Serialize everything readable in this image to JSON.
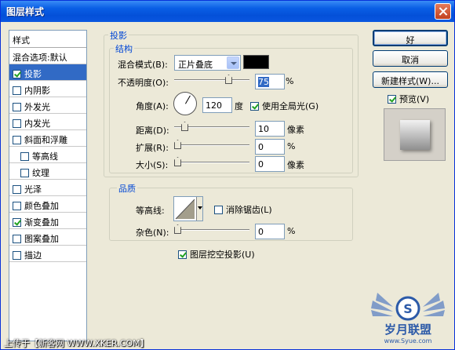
{
  "window": {
    "title": "图层样式"
  },
  "styles_list": {
    "header": "样式",
    "items": [
      {
        "label": "混合选项:默认",
        "checkbox": false,
        "checked": false,
        "selected": false,
        "indent": false
      },
      {
        "label": "投影",
        "checkbox": true,
        "checked": true,
        "selected": true,
        "indent": false
      },
      {
        "label": "内阴影",
        "checkbox": true,
        "checked": false,
        "selected": false,
        "indent": false
      },
      {
        "label": "外发光",
        "checkbox": true,
        "checked": false,
        "selected": false,
        "indent": false
      },
      {
        "label": "内发光",
        "checkbox": true,
        "checked": false,
        "selected": false,
        "indent": false
      },
      {
        "label": "斜面和浮雕",
        "checkbox": true,
        "checked": false,
        "selected": false,
        "indent": false
      },
      {
        "label": "等高线",
        "checkbox": true,
        "checked": false,
        "selected": false,
        "indent": true
      },
      {
        "label": "纹理",
        "checkbox": true,
        "checked": false,
        "selected": false,
        "indent": true
      },
      {
        "label": "光泽",
        "checkbox": true,
        "checked": false,
        "selected": false,
        "indent": false
      },
      {
        "label": "颜色叠加",
        "checkbox": true,
        "checked": false,
        "selected": false,
        "indent": false
      },
      {
        "label": "渐变叠加",
        "checkbox": true,
        "checked": true,
        "selected": false,
        "indent": false
      },
      {
        "label": "图案叠加",
        "checkbox": true,
        "checked": false,
        "selected": false,
        "indent": false
      },
      {
        "label": "描边",
        "checkbox": true,
        "checked": false,
        "selected": false,
        "indent": false
      }
    ]
  },
  "drop_shadow": {
    "section_title": "投影",
    "structure_title": "结构",
    "blend_mode_label": "混合模式(B):",
    "blend_mode_value": "正片叠底",
    "shadow_color": "#000000",
    "opacity_label": "不透明度(O):",
    "opacity_value": "75",
    "opacity_unit": "%",
    "opacity_level": 0.75,
    "angle_label": "角度(A):",
    "angle_value": "120",
    "angle_unit": "度",
    "global_light_label": "使用全局光(G)",
    "global_light_checked": true,
    "distance_label": "距离(D):",
    "distance_value": "10",
    "distance_unit": "像素",
    "distance_level": 0.1,
    "spread_label": "扩展(R):",
    "spread_value": "0",
    "spread_unit": "%",
    "size_label": "大小(S):",
    "size_value": "0",
    "size_unit": "像素",
    "quality_title": "品质",
    "contour_label": "等高线:",
    "anti_alias_label": "消除锯齿(L)",
    "anti_alias_checked": false,
    "noise_label": "杂色(N):",
    "noise_value": "0",
    "noise_unit": "%",
    "knockout_label": "图层挖空投影(U)",
    "knockout_checked": true
  },
  "buttons": {
    "ok": "好",
    "cancel": "取消",
    "new_style": "新建样式(W)...",
    "preview_label": "预览(V)",
    "preview_checked": true
  },
  "footer": {
    "credit": "上传于【新客网 WWW.XKER.COM】",
    "logo_text": "岁月联盟",
    "logo_url": "www.Syue.com"
  },
  "colors": {
    "titlebar": "#0a5fe5",
    "selection": "#316ac5",
    "group_title": "#0046d5"
  }
}
